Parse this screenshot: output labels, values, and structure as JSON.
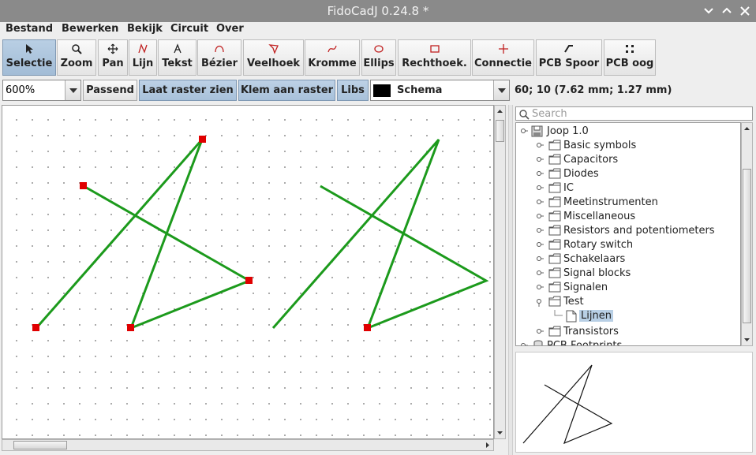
{
  "window": {
    "title": "FidoCadJ 0.24.8  *",
    "controls": {
      "minimize": "⌄",
      "maximize": "⌃",
      "close": "✕"
    }
  },
  "menu": [
    "Bestand",
    "Bewerken",
    "Bekijk",
    "Circuit",
    "Over"
  ],
  "toolbar": {
    "tools": [
      {
        "label": "Selectie",
        "icon": "arrow-pointer-icon",
        "active": true
      },
      {
        "label": "Zoom",
        "icon": "magnifier-icon"
      },
      {
        "label": "Pan",
        "icon": "move-cross-icon"
      },
      {
        "label": "Lijn",
        "icon": "line-icon"
      },
      {
        "label": "Tekst",
        "icon": "text-icon"
      },
      {
        "label": "Bézier",
        "icon": "bezier-icon"
      },
      {
        "label": "Veelhoek",
        "icon": "polygon-icon"
      },
      {
        "label": "Kromme",
        "icon": "curve-icon"
      },
      {
        "label": "Ellips",
        "icon": "ellipse-icon"
      },
      {
        "label": "Rechthoek.",
        "icon": "rectangle-icon"
      },
      {
        "label": "Connectie",
        "icon": "connection-icon"
      },
      {
        "label": "PCB Spoor",
        "icon": "pcb-track-icon"
      },
      {
        "label": "PCB oog",
        "icon": "pcb-pad-icon"
      }
    ]
  },
  "options": {
    "zoom_value": "600%",
    "fit_label": "Passend",
    "show_grid_label": "Laat raster zien",
    "snap_grid_label": "Klem aan raster",
    "libs_label": "Libs",
    "layer_name": "Schema",
    "layer_color": "#000000",
    "coordinates": "60; 10 (7.62 mm; 1.27 mm)"
  },
  "colors": {
    "drawing": "#1c9a1c",
    "handle": "#e00000",
    "selection_blue": "#a8c1da"
  },
  "library": {
    "search_placeholder": "Search",
    "root": "Joop 1.0",
    "items": [
      {
        "label": "Basic symbols"
      },
      {
        "label": "Capacitors"
      },
      {
        "label": "Diodes"
      },
      {
        "label": "IC"
      },
      {
        "label": "Meetinstrumenten"
      },
      {
        "label": "Miscellaneous"
      },
      {
        "label": "Resistors and potentiometers"
      },
      {
        "label": "Rotary switch"
      },
      {
        "label": "Schakelaars"
      },
      {
        "label": "Signal blocks"
      },
      {
        "label": "Signalen"
      },
      {
        "label": "Test",
        "expanded": true
      },
      {
        "label": "Lijnen",
        "selected": true,
        "leaf": true
      },
      {
        "label": "Transistors"
      }
    ],
    "next_root": "PCB Footprints"
  }
}
